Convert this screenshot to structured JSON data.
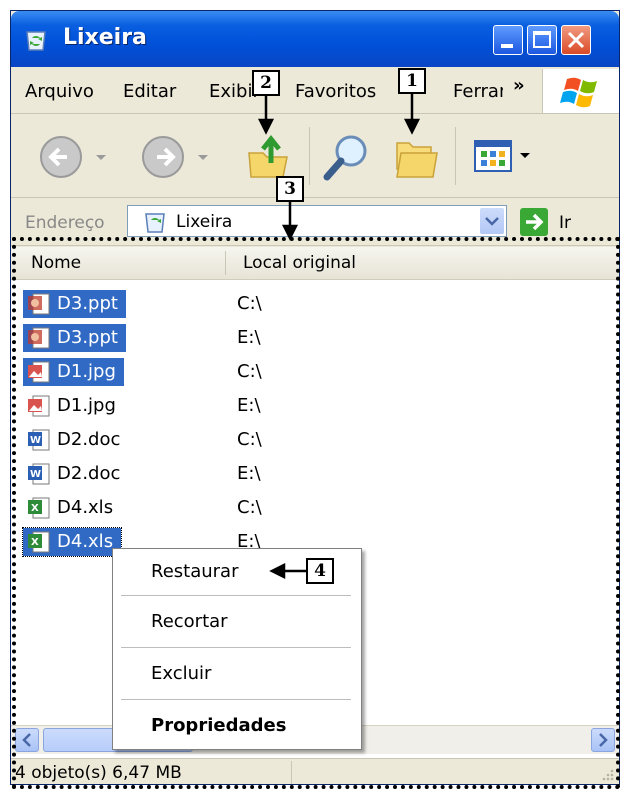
{
  "window": {
    "title": "Lixeira"
  },
  "menubar": {
    "items": [
      "Arquivo",
      "Editar",
      "Exibir",
      "Favoritos",
      "Ferramentas"
    ],
    "overflow": "»"
  },
  "toolbar": {
    "icons": [
      "back-icon",
      "forward-icon",
      "up-folder-icon",
      "search-icon",
      "folders-icon",
      "views-icon"
    ]
  },
  "address": {
    "label": "Endereço",
    "value": "Lixeira",
    "go_label": "Ir"
  },
  "columns": {
    "name": "Nome",
    "location": "Local original"
  },
  "files": [
    {
      "name": "D3.ppt",
      "location": "C:\\",
      "type": "ppt",
      "selected": true
    },
    {
      "name": "D3.ppt",
      "location": "E:\\",
      "type": "ppt",
      "selected": true
    },
    {
      "name": "D1.jpg",
      "location": "C:\\",
      "type": "jpg",
      "selected": true
    },
    {
      "name": "D1.jpg",
      "location": "E:\\",
      "type": "jpg",
      "selected": false
    },
    {
      "name": "D2.doc",
      "location": "C:\\",
      "type": "doc",
      "selected": false
    },
    {
      "name": "D2.doc",
      "location": "E:\\",
      "type": "doc",
      "selected": false
    },
    {
      "name": "D4.xls",
      "location": "C:\\",
      "type": "xls",
      "selected": false
    },
    {
      "name": "D4.xls",
      "location": "E:\\",
      "type": "xls",
      "selected": true
    }
  ],
  "context_menu": {
    "items": [
      "Restaurar",
      "Recortar",
      "Excluir",
      "Propriedades"
    ]
  },
  "status": {
    "text": "4 objeto(s) 6,47 MB"
  },
  "callouts": [
    "1",
    "2",
    "3",
    "4"
  ],
  "colors": {
    "title_blue": "#0054e3",
    "selection": "#316ac5",
    "chrome": "#ece9d8"
  }
}
